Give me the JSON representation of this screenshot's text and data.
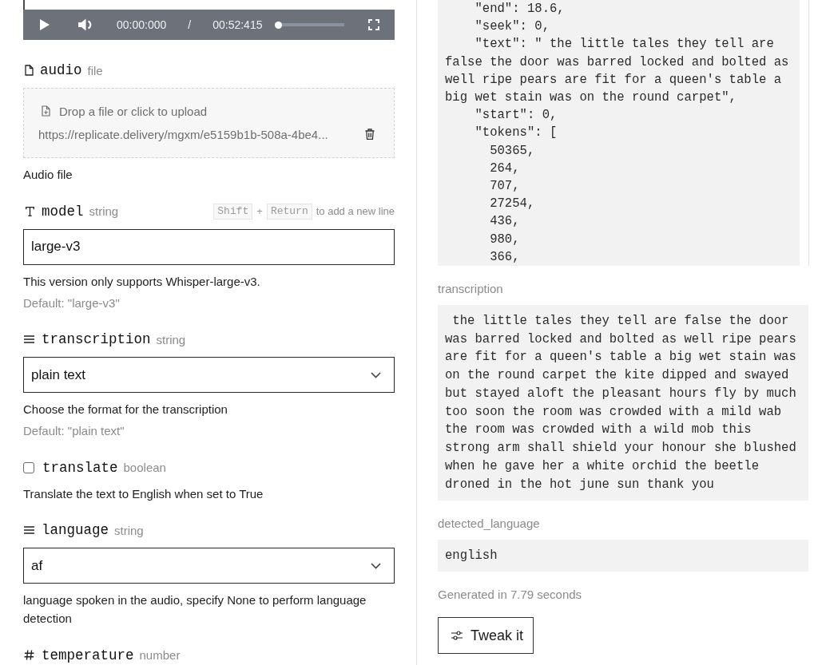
{
  "media_player": {
    "current_time": "00:00:000",
    "separator": "/",
    "duration": "00:52:415",
    "level": 0
  },
  "inputs": [
    {
      "kind": "file",
      "name": "audio",
      "type": "file",
      "dropzone_text": "Drop a file or click to upload",
      "value": "https://replicate.delivery/mgxm/e5159b1b-508a-4be4...",
      "description": "Audio file"
    },
    {
      "kind": "text",
      "name": "model",
      "type": "string",
      "hint": {
        "keys": [
          "Shift",
          "Return"
        ],
        "joiner": "+",
        "text": "to add a new line"
      },
      "value": "large-v3",
      "description": "This version only supports Whisper-large-v3.",
      "default": "Default: \"large-v3\""
    },
    {
      "kind": "select",
      "name": "transcription",
      "type": "string",
      "value": "plain text",
      "description": "Choose the format for the transcription",
      "default": "Default: \"plain text\""
    },
    {
      "kind": "checkbox",
      "name": "translate",
      "type": "boolean",
      "checked": false,
      "description": "Translate the text to English when set to True"
    },
    {
      "kind": "select",
      "name": "language",
      "type": "string",
      "value": "af",
      "description": "language spoken in the audio, specify None to perform language detection"
    },
    {
      "kind": "number",
      "name": "temperature",
      "type": "number"
    }
  ],
  "output": {
    "json_output": "    \"end\": 18.6,\n    \"seek\": 0,\n    \"text\": \" the little tales they tell are false the door was barred locked and bolted as well ripe pears are fit for a queen's table a big wet stain was on the round carpet\",\n    \"start\": 0,\n    \"tokens\": [\n      50365,\n      264,\n      707,\n      27254,\n      436,\n      980,\n      366,",
    "fields": [
      {
        "label": "transcription",
        "text": " the little tales they tell are false the door was barred locked and bolted as well ripe pears are fit for a queen's table a big wet stain was on the round carpet the kite dipped and swayed but stayed aloft the pleasant hours fly by much too soon the room was crowded with a mild wab the room was crowded with a wild mob this strong arm shall shield your honour she blushed when he gave her a white orchid the beetle droned in the hot june sun thank you"
      },
      {
        "label": "detected_language",
        "text": "english"
      }
    ],
    "timing": "Generated in 7.79 seconds",
    "tweak_button": "Tweak it"
  }
}
